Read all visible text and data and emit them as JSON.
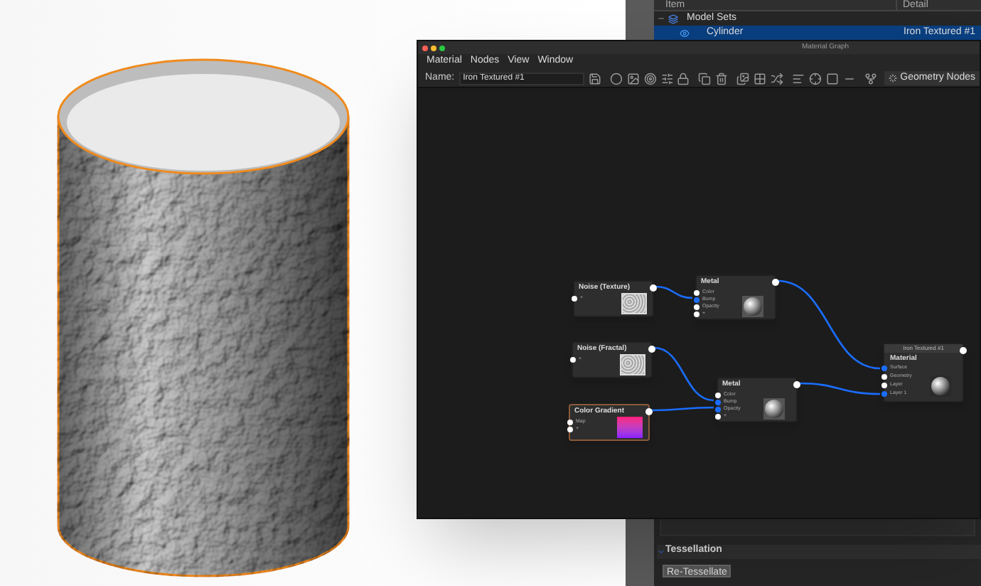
{
  "outliner": {
    "columns": [
      "Item",
      "Detail"
    ],
    "rows": [
      {
        "label": "Model Sets",
        "detail": "",
        "selected": false,
        "expanded": true,
        "visible": false
      },
      {
        "label": "Cylinder",
        "detail": "Iron Textured #1",
        "selected": true,
        "expanded": false,
        "visible": true
      }
    ]
  },
  "window": {
    "title": "Material Graph",
    "menu": [
      "Material",
      "Nodes",
      "View",
      "Window"
    ],
    "name_label": "Name:",
    "name_value": "Iron Textured #1",
    "geometry_button": "Geometry Nodes"
  },
  "nodes": [
    {
      "kind": "noise",
      "title": "Noise (Texture)",
      "ports": [
        {
          "label": "+",
          "connected": false
        }
      ]
    },
    {
      "kind": "metal",
      "title": "Metal",
      "ports": [
        {
          "label": "Color",
          "connected": false
        },
        {
          "label": "Bump",
          "connected": true
        },
        {
          "label": "Opacity",
          "connected": false
        },
        {
          "label": "+",
          "connected": false
        }
      ]
    },
    {
      "kind": "noise",
      "title": "Noise (Fractal)",
      "ports": [
        {
          "label": "+",
          "connected": false
        }
      ]
    },
    {
      "kind": "metal",
      "title": "Metal",
      "ports": [
        {
          "label": "Color",
          "connected": false
        },
        {
          "label": "Bump",
          "connected": true
        },
        {
          "label": "Opacity",
          "connected": true
        },
        {
          "label": "+",
          "connected": false
        }
      ]
    },
    {
      "kind": "gradient",
      "title": "Color Gradient",
      "ports": [
        {
          "label": "Map",
          "connected": false
        },
        {
          "label": "+",
          "connected": false
        }
      ]
    },
    {
      "kind": "output",
      "title": "Iron Textured #1",
      "subtitle": "Material",
      "ports": [
        {
          "label": "Surface",
          "connected": true
        },
        {
          "label": "Geometry",
          "connected": false
        },
        {
          "label": "Layer",
          "connected": false
        },
        {
          "label": "Layer 1",
          "connected": true
        }
      ]
    }
  ],
  "tessellation": {
    "title": "Tessellation",
    "expanded": true,
    "button": "Re-Tessellate"
  }
}
